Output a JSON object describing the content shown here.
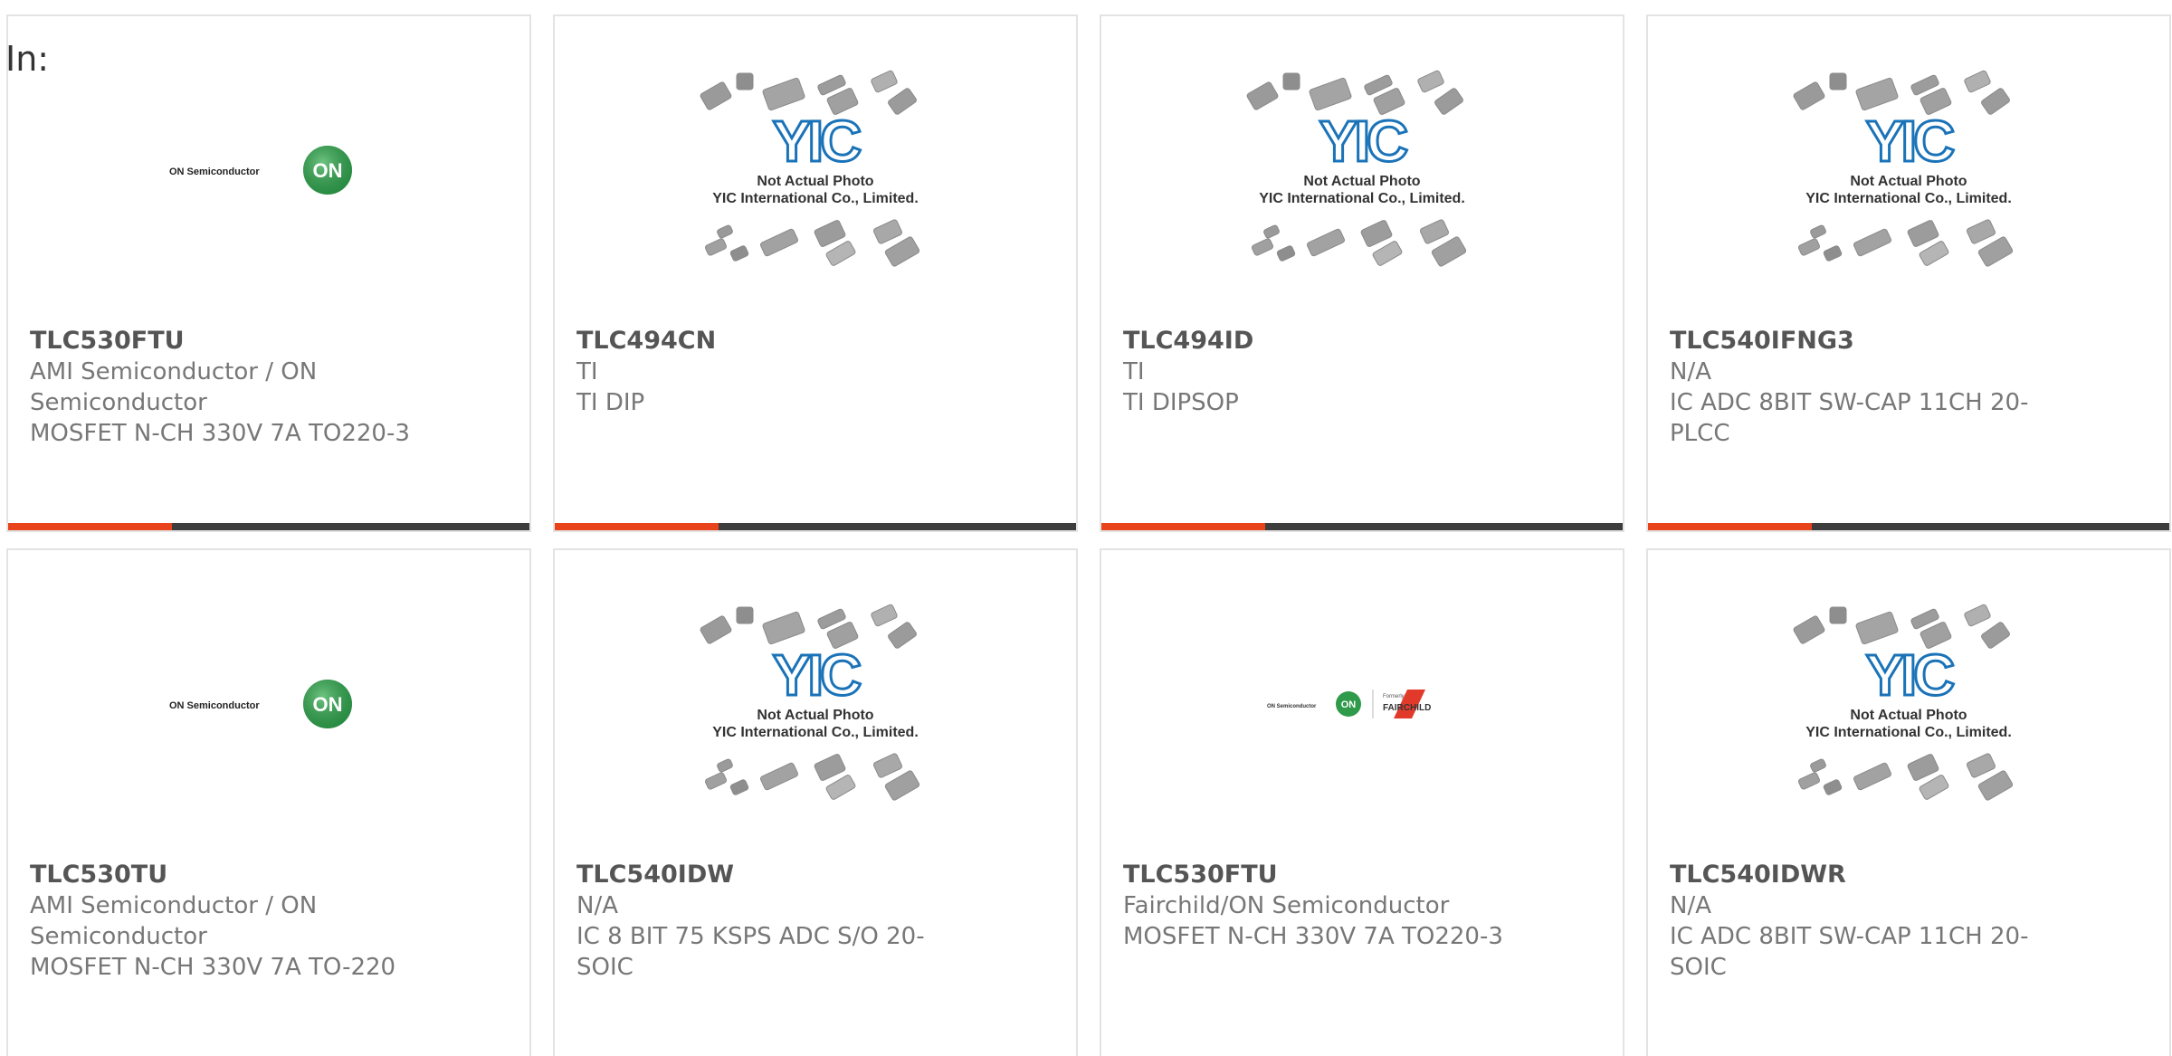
{
  "header": {
    "label": "In:"
  },
  "colors": {
    "accent": "#e8431a",
    "bar_dark": "#3d3d3d",
    "on_green": "#2e9a4a"
  },
  "placeholder_image": {
    "logo_text": "YIC",
    "line1": "Not Actual Photo",
    "line2": "YIC International Co., Limited."
  },
  "logos": {
    "on_semi": "ON Semiconductor",
    "on_badge": "ON",
    "fairchild_small": "Formerly",
    "fairchild": "FAIRCHILD"
  },
  "products": [
    {
      "part": "TLC530FTU",
      "maker": "AMI Semiconductor / ON Semiconductor",
      "desc": "MOSFET N-CH 330V 7A TO220-3",
      "image": "on-semi-logo"
    },
    {
      "part": "TLC494CN",
      "maker": "TI",
      "desc": "TI DIP",
      "image": "placeholder"
    },
    {
      "part": "TLC494ID",
      "maker": "TI",
      "desc": "TI DIPSOP",
      "image": "placeholder"
    },
    {
      "part": "TLC540IFNG3",
      "maker": "N/A",
      "desc": "IC ADC 8BIT SW-CAP 11CH 20-PLCC",
      "image": "placeholder"
    },
    {
      "part": "TLC530TU",
      "maker": "AMI Semiconductor / ON Semiconductor",
      "desc": "MOSFET N-CH 330V 7A TO-220",
      "image": "on-semi-logo"
    },
    {
      "part": "TLC540IDW",
      "maker": "N/A",
      "desc": "IC 8 BIT 75 KSPS ADC S/O 20-SOIC",
      "image": "placeholder"
    },
    {
      "part": "TLC530FTU",
      "maker": "Fairchild/ON Semiconductor",
      "desc": "MOSFET N-CH 330V 7A TO220-3",
      "image": "on-fairchild-logo"
    },
    {
      "part": "TLC540IDWR",
      "maker": "N/A",
      "desc": "IC ADC 8BIT SW-CAP 11CH 20-SOIC",
      "image": "placeholder"
    }
  ]
}
